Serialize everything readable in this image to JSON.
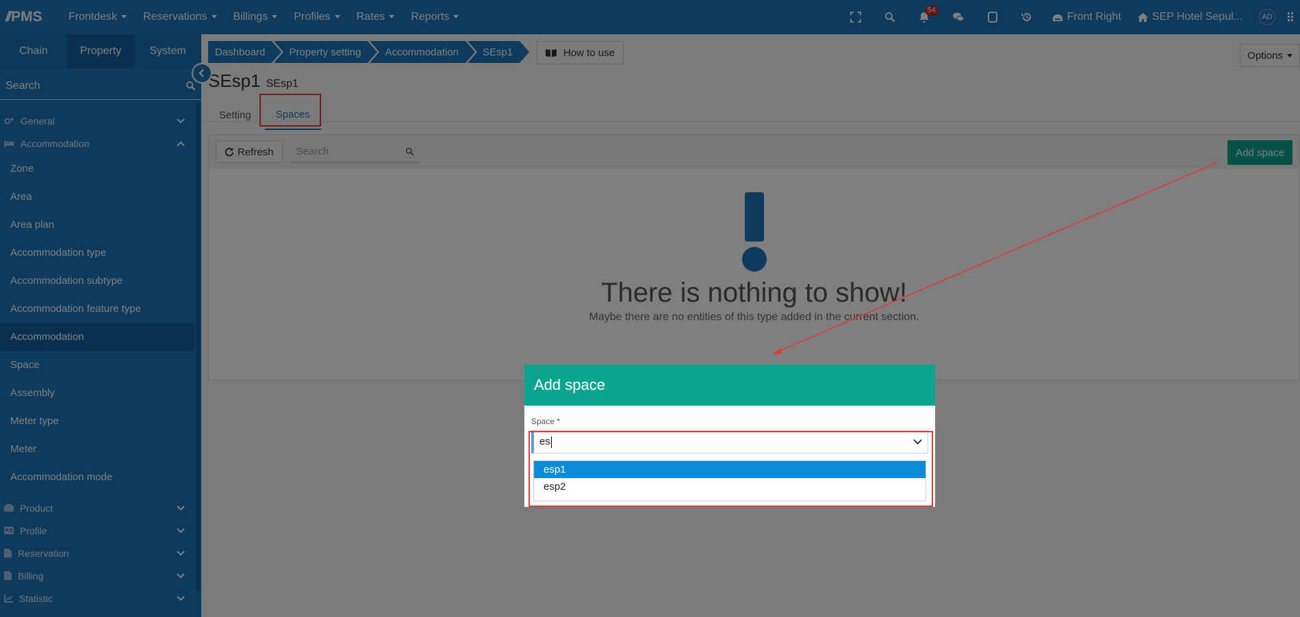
{
  "brand": {
    "logo": "PMS"
  },
  "topnav": [
    {
      "label": "Frontdesk"
    },
    {
      "label": "Reservations"
    },
    {
      "label": "Billings"
    },
    {
      "label": "Profiles"
    },
    {
      "label": "Rates"
    },
    {
      "label": "Reports"
    }
  ],
  "topright": {
    "notifications": "54",
    "front_label": "Front Right",
    "hotel_label": "SEP Hotel Sepul...",
    "avatar": "AD"
  },
  "sidebar": {
    "tabs": [
      {
        "label": "Chain"
      },
      {
        "label": "Property"
      },
      {
        "label": "System"
      }
    ],
    "search_placeholder": "Search",
    "groups_top": [
      {
        "label": "General"
      },
      {
        "label": "Accommodation"
      }
    ],
    "items": [
      {
        "label": "Zone"
      },
      {
        "label": "Area"
      },
      {
        "label": "Area plan"
      },
      {
        "label": "Accommodation type"
      },
      {
        "label": "Accommodation subtype"
      },
      {
        "label": "Accommodation feature type"
      },
      {
        "label": "Accommodation"
      },
      {
        "label": "Space"
      },
      {
        "label": "Assembly"
      },
      {
        "label": "Meter type"
      },
      {
        "label": "Meter"
      },
      {
        "label": "Accommodation mode"
      }
    ],
    "groups_bottom": [
      {
        "label": "Product"
      },
      {
        "label": "Profile"
      },
      {
        "label": "Reservation"
      },
      {
        "label": "Billing"
      },
      {
        "label": "Statistic"
      }
    ]
  },
  "breadcrumb": [
    {
      "label": "Dashboard"
    },
    {
      "label": "Property setting"
    },
    {
      "label": "Accommodation"
    },
    {
      "label": "SEsp1"
    }
  ],
  "how_to_use": "How to use",
  "options_label": "Options",
  "page": {
    "title": "SEsp1",
    "subtitle": "SEsp1"
  },
  "tabs": [
    {
      "label": "Setting"
    },
    {
      "label": "Spaces"
    }
  ],
  "toolbar": {
    "refresh": "Refresh",
    "search_placeholder": "Search",
    "add_space": "Add space"
  },
  "empty": {
    "message": "There is nothing to show!",
    "sub": "Maybe there are no entities of this type added in the current section."
  },
  "modal": {
    "title": "Add space",
    "field_label": "Space *",
    "input_value": "es",
    "options": [
      {
        "label": "esp1"
      },
      {
        "label": "esp2"
      }
    ]
  },
  "colors": {
    "primary": "#1c75bc",
    "teal": "#0aa58f",
    "highlight": "#e23a3a",
    "badge": "#c9302c"
  }
}
